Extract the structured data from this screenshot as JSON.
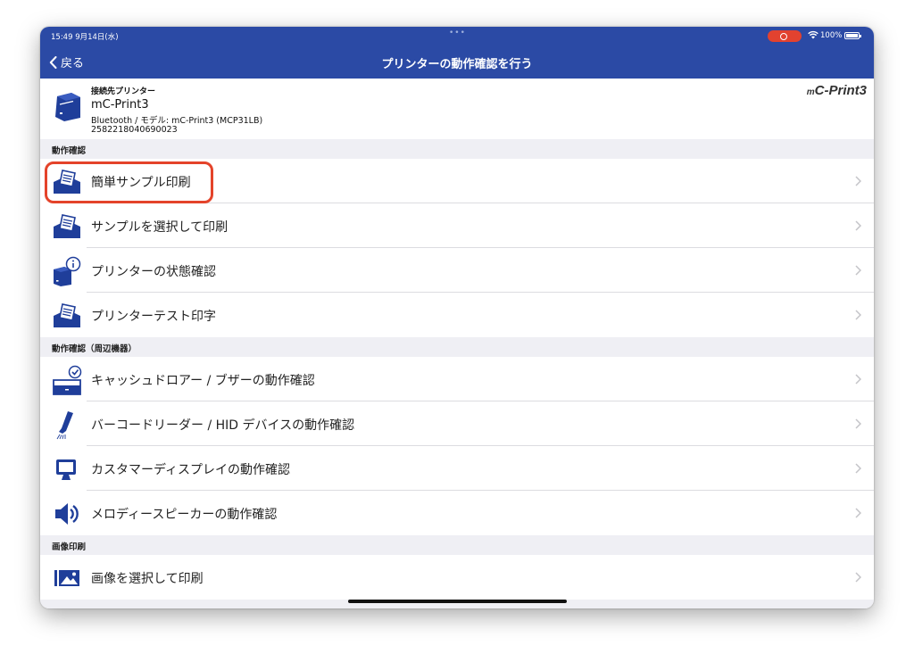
{
  "status_bar": {
    "time": "15:49  9月14日(水)",
    "dots": "•••",
    "battery": "100%"
  },
  "nav": {
    "back_label": "戻る",
    "title": "プリンターの動作確認を行う"
  },
  "printer": {
    "heading": "接続先プリンター",
    "name": "mC-Print3",
    "detail": "Bluetooth / モデル: mC-Print3 (MCP31LB)",
    "serial": "2582218040690023",
    "brand_prefix": "m",
    "brand_main": "C-Print3"
  },
  "sections": [
    {
      "header": "動作確認"
    },
    {
      "header": "動作確認（周辺機器）"
    },
    {
      "header": "画像印刷"
    }
  ],
  "items": [
    {
      "label": "簡単サンプル印刷",
      "icon": "receipt-print-icon"
    },
    {
      "label": "サンプルを選択して印刷",
      "icon": "receipt-print-icon"
    },
    {
      "label": "プリンターの状態確認",
      "icon": "printer-info-icon"
    },
    {
      "label": "プリンターテスト印字",
      "icon": "receipt-print-icon"
    },
    {
      "label": "キャッシュドロアー / ブザーの動作確認",
      "icon": "cash-drawer-icon"
    },
    {
      "label": "バーコードリーダー / HID デバイスの動作確認",
      "icon": "barcode-scanner-icon"
    },
    {
      "label": "カスタマーディスプレイの動作確認",
      "icon": "monitor-icon"
    },
    {
      "label": "メロディースピーカーの動作確認",
      "icon": "speaker-icon"
    },
    {
      "label": "画像を選択して印刷",
      "icon": "image-icon"
    }
  ],
  "colors": {
    "nav": "#2b4aa5",
    "accent": "#1f3e9a",
    "highlight": "#e4432a"
  }
}
